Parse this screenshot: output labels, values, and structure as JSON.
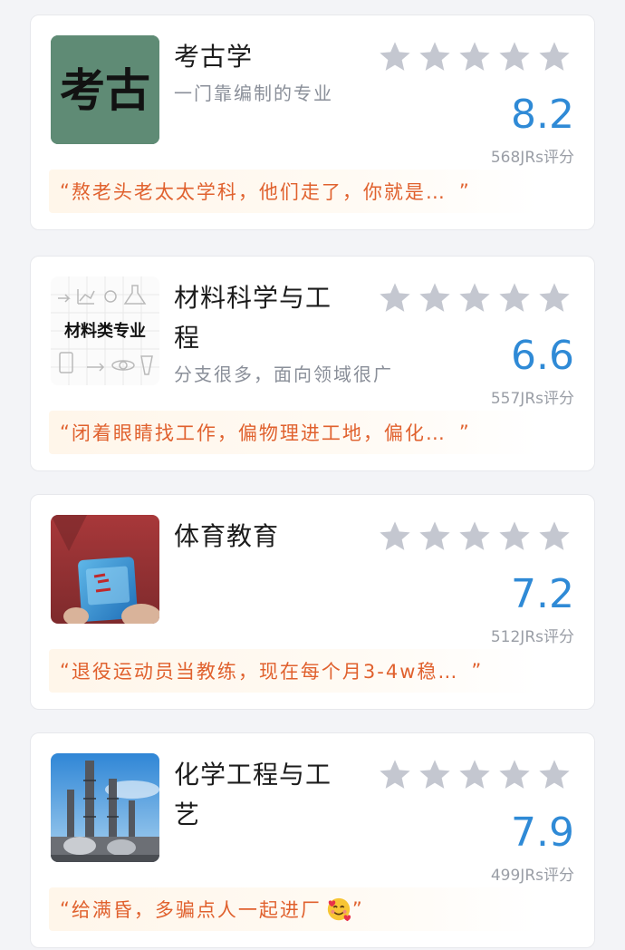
{
  "majors": [
    {
      "title": "考古学",
      "subtitle": "一门靠编制的专业",
      "score": "8.2",
      "rating_count": "568JRs评分",
      "quote": "熬老头老太太学科，他们走了，你就是…",
      "thumbnail_text": "考古",
      "thumbnail_desc": "calligraphy"
    },
    {
      "title": "材料科学与工程",
      "subtitle": "分支很多，面向领域很广",
      "score": "6.6",
      "rating_count": "557JRs评分",
      "quote": "闭着眼睛找工作，偏物理进工地，偏化…",
      "thumbnail_text": "材料类专业",
      "thumbnail_desc": "sketch"
    },
    {
      "title": "体育教育",
      "subtitle": "",
      "score": "7.2",
      "rating_count": "512JRs评分",
      "quote": "退役运动员当教练，现在每个月3-4w稳…",
      "thumbnail_text": "",
      "thumbnail_desc": "card-photo"
    },
    {
      "title": "化学工程与工艺",
      "subtitle": "",
      "score": "7.9",
      "rating_count": "499JRs评分",
      "quote": "给满昏，多骗点人一起进厂",
      "thumbnail_text": "",
      "thumbnail_desc": "plant-photo"
    }
  ],
  "quote_open": "“",
  "quote_close": "”",
  "colors": {
    "score": "#2f8ad6",
    "quote": "#e0612e",
    "star_empty": "#c4c7d0"
  },
  "icons": {
    "star": "star-icon",
    "emoji": "smiling-face-with-hearts-icon"
  }
}
